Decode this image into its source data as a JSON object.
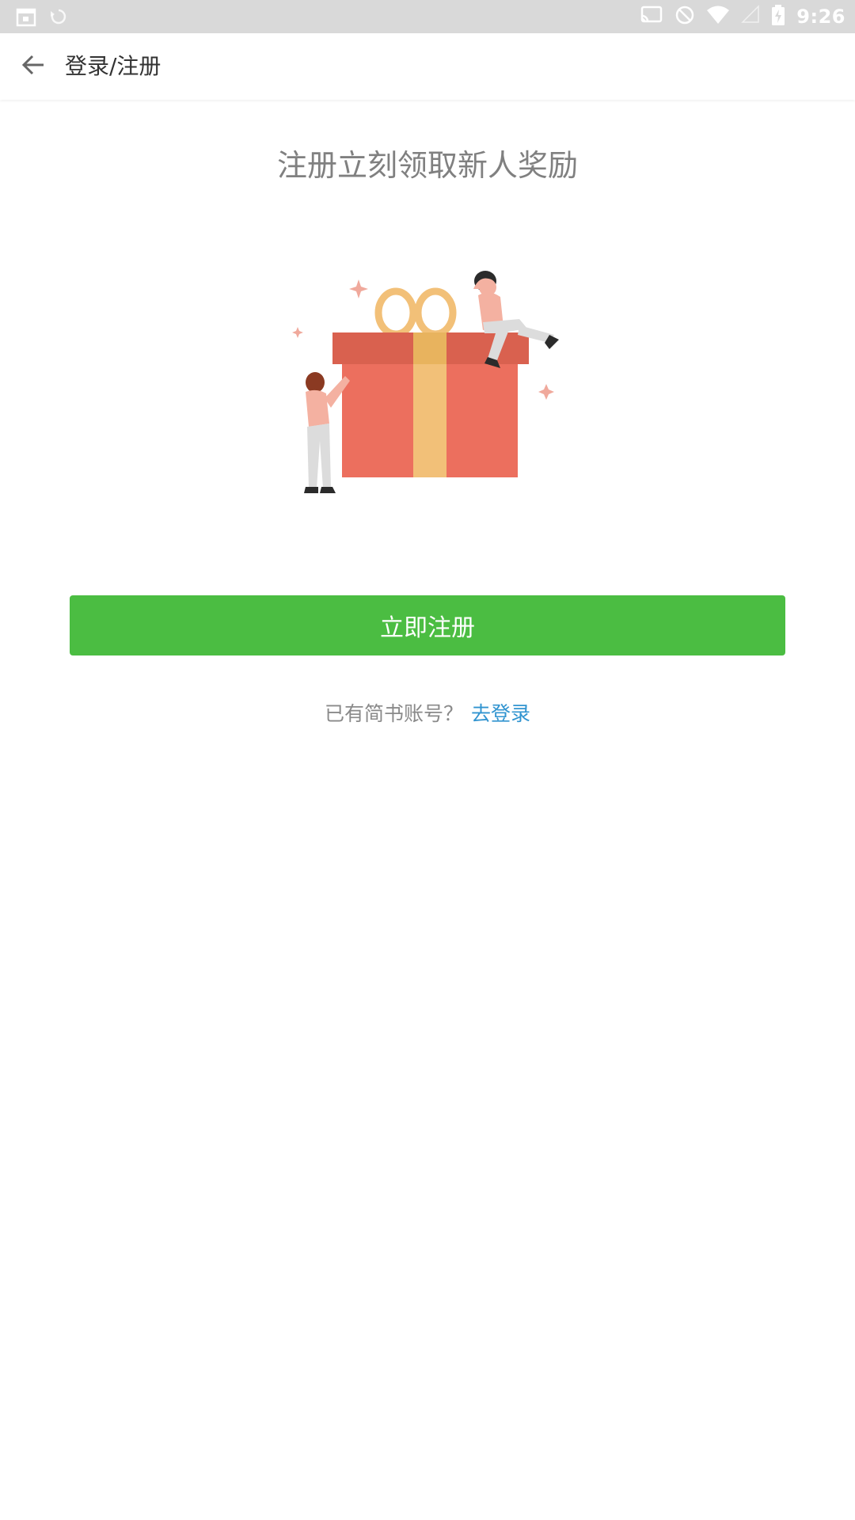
{
  "status_bar": {
    "time": "9:26",
    "icons": [
      "calendar-icon",
      "sync-icon",
      "cast-icon",
      "do-not-disturb-icon",
      "wifi-icon",
      "signal-icon",
      "battery-charging-icon"
    ]
  },
  "toolbar": {
    "back_icon": "arrow-left-icon",
    "title": "登录/注册"
  },
  "main": {
    "headline": "注册立刻领取新人奖励",
    "illustration": "gift-box-with-people",
    "register_button_label": "立即注册",
    "login_prompt": "已有简书账号？",
    "login_link_label": "去登录"
  },
  "colors": {
    "accent_green": "#4bbd42",
    "link_blue": "#3194d0",
    "status_bar_bg": "#d9d9d9",
    "gift_red": "#ec6f5e",
    "gift_lid": "#d9614f",
    "ribbon": "#f2c078"
  }
}
